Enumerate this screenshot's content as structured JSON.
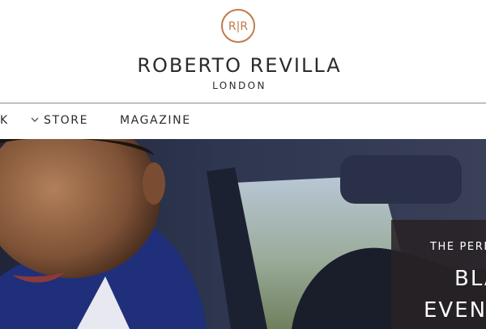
{
  "brand": {
    "monogram": "R|R",
    "name": "ROBERTO REVILLA",
    "city": "LONDON",
    "accent_color": "#c07a4a"
  },
  "nav": {
    "items": [
      {
        "label": "K"
      },
      {
        "label": "STORE",
        "icon": "chevron-down-icon"
      },
      {
        "label": "MAGAZINE"
      }
    ]
  },
  "hero": {
    "image": "man-in-suit-in-car-photo",
    "kicker": "THE PERF",
    "title_line1": "BLA",
    "title_line2": "EVEN"
  }
}
